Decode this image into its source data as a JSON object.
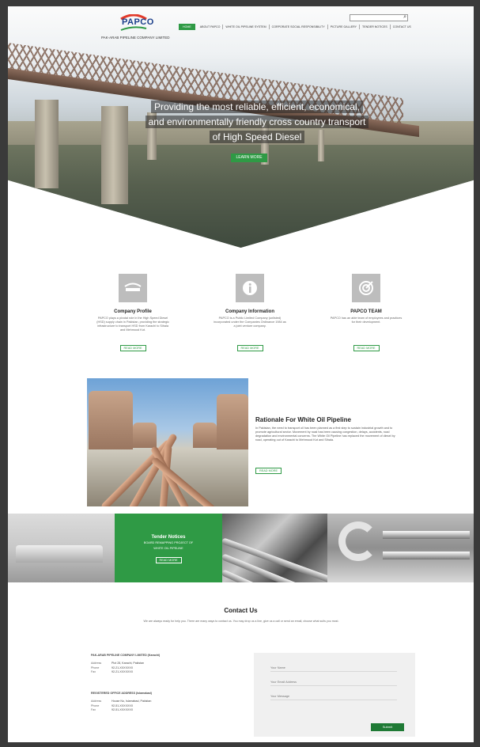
{
  "brand": {
    "logo_text": "PAPCO",
    "company_name": "PAK-ARAB PIPELINE COMPANY LIMITED"
  },
  "search": {
    "placeholder": ""
  },
  "nav": {
    "items": [
      "HOME",
      "ABOUT PAPCO",
      "WHITE OIL PIPELINE SYSTEM",
      "CORPORATE SOCIAL RESPONSIBILITY",
      "PICTURE GALLERY",
      "TENDER NOTICES",
      "CONTACT US"
    ]
  },
  "hero": {
    "line1": "Providing the most reliable, efficient, economical,",
    "line2": "and environmentally friendly cross country transport",
    "line3": "of High Speed Diesel",
    "button": "LEARN MORE"
  },
  "features": [
    {
      "title": "Company Profile",
      "text": "PAPCO plays a pivotal role in the High Speed Diesel (HSD) supply chain in Pakistan, providing the strategic infrastructure to transport HSD from Karachi to Sihala and Mehmood Kot.",
      "button": "READ MORE",
      "icon": "papco-logo-icon"
    },
    {
      "title": "Company Information",
      "text": "PAPCO is a Public Limited Company (unlisted) incorporated under the Companies Ordinance 1984 as a joint venture company.",
      "button": "READ MORE",
      "icon": "info-icon"
    },
    {
      "title": "PAPCO TEAM",
      "text": "PAPCO has an able team of employees and practices for their development.",
      "button": "READ MORE",
      "icon": "target-icon"
    }
  ],
  "rationale": {
    "title": "Rationale For White Oil Pipeline",
    "text": "In Pakistan, the need to transport oil has been planned as a first step to sustain industrial growth and to promote agricultural sector. Movement by road has been causing congestion, delays, accidents, road degradation and environmental concerns. The White Oil Pipeline has replaced the movement of diesel by road, operating out of Karachi to Mehmood Kot and Sihala.",
    "button": "READ MORE"
  },
  "tender": {
    "title": "Tender Notices",
    "subtitle1": "BOARD REMAPPING PROJECT OF",
    "subtitle2": "WHITE OIL PIPELINE",
    "button": "READ MORE"
  },
  "contact": {
    "title": "Contact Us",
    "text": "We are always ready for help you. There are many ways to contact us. You may drop us a line, give us a call or send an email, choose what suits you most."
  },
  "offices": [
    {
      "title": "PAK-ARAB PIPELINE COMPANY LIMITED (Karachi)",
      "rows": [
        {
          "k": "Address",
          "v": "Plot 28, Karachi, Pakistan"
        },
        {
          "k": "Phone",
          "v": "92-21-XXXXXXX"
        },
        {
          "k": "Fax",
          "v": "92-21-XXXXXXX"
        }
      ]
    },
    {
      "title": "REGISTERED OFFICE ADDRESS (Islamabad)",
      "rows": [
        {
          "k": "Address",
          "v": "House No, Islamabad, Pakistan"
        },
        {
          "k": "Phone",
          "v": "92-51-XXXXXXX"
        },
        {
          "k": "Fax",
          "v": "92-51-XXXXXXX"
        }
      ]
    }
  ],
  "form": {
    "name_placeholder": "Your Name",
    "email_placeholder": "Your Email Address",
    "message_placeholder": "Your Message",
    "submit": "Submit"
  },
  "colors": {
    "accent": "#2f9a45",
    "dark_accent": "#1f7a35"
  }
}
